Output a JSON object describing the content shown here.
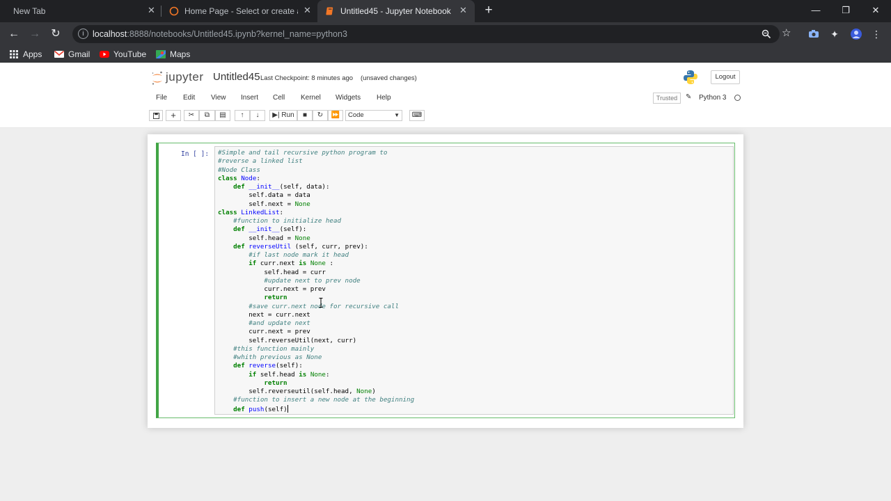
{
  "browser": {
    "tabs": [
      {
        "title": "New Tab",
        "active": false
      },
      {
        "title": "Home Page - Select or create a n",
        "active": false
      },
      {
        "title": "Untitled45 - Jupyter Notebook",
        "active": true
      }
    ],
    "url_host": "localhost",
    "url_path": ":8888/notebooks/Untitled45.ipynb?kernel_name=python3",
    "bookmarks": [
      {
        "label": "Apps",
        "icon": "apps-grid-icon"
      },
      {
        "label": "Gmail",
        "icon": "gmail-icon"
      },
      {
        "label": "YouTube",
        "icon": "youtube-icon"
      },
      {
        "label": "Maps",
        "icon": "maps-icon"
      }
    ]
  },
  "jupyter": {
    "logo_text": "jupyter",
    "notebook_name": "Untitled45",
    "checkpoint": "Last Checkpoint: 8 minutes ago",
    "unsaved": "(unsaved changes)",
    "logout": "Logout",
    "menus": [
      "File",
      "Edit",
      "View",
      "Insert",
      "Cell",
      "Kernel",
      "Widgets",
      "Help"
    ],
    "trusted": "Trusted",
    "kernel": "Python 3",
    "toolbar": {
      "run_label": "Run",
      "cell_type": "Code"
    },
    "cell": {
      "prompt": "In [ ]:",
      "code_lines": [
        "#Simple and tail recursive python program to",
        "#reverse a linked list",
        "#Node Class",
        "class Node:",
        "    def __init__(self, data):",
        "        self.data = data",
        "        self.next = None",
        "class LinkedList:",
        "    #function to initialize head",
        "    def __init__(self):",
        "        self.head = None",
        "    def reverseUtil (self, curr, prev):",
        "        #if last node mark it head",
        "        if curr.next is None :",
        "            self.head = curr",
        "            #update next to prev node",
        "            curr.next = prev",
        "            return",
        "        #save curr.next node for recursive call",
        "        next = curr.next",
        "        #and update next",
        "        curr.next = prev",
        "        self.reverseUtil(next, curr)",
        "    #this function mainly",
        "    #whith previous as None",
        "    def reverse(self):",
        "        if self.head is None:",
        "            return",
        "        self.reverseutil(self.head, None)",
        "    #function to insert a new node at the beginning",
        "    def push(self)"
      ]
    }
  },
  "colors": {
    "chrome_dark": "#202124",
    "chrome_toolbar": "#35363a",
    "cell_border": "#42a545",
    "jupyter_orange": "#f37726"
  }
}
